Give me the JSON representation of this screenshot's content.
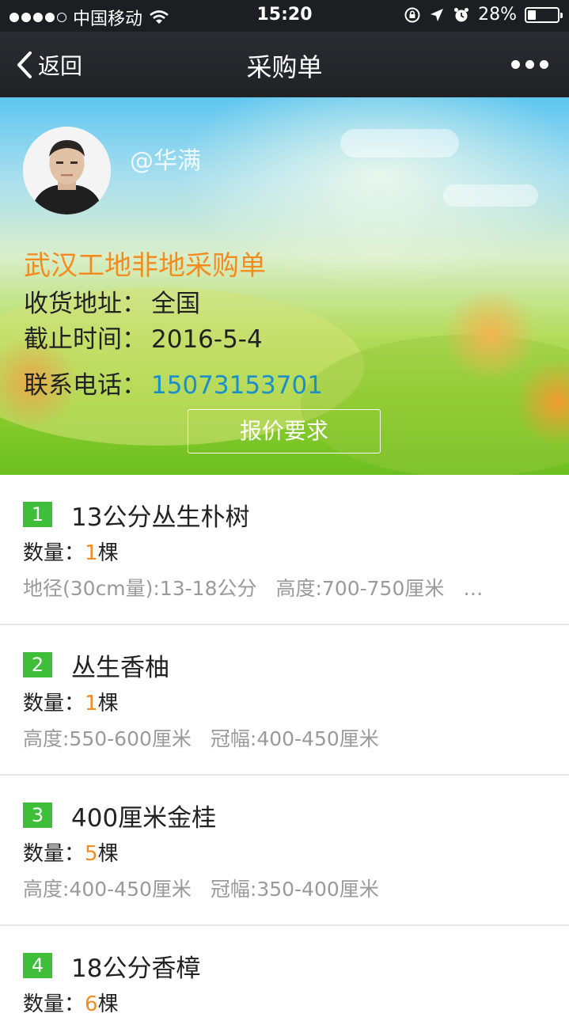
{
  "status_bar": {
    "carrier": "中国移动",
    "time": "15:20",
    "battery": "28%",
    "battery_level": 0.28
  },
  "nav": {
    "back_label": "返回",
    "title": "采购单"
  },
  "header": {
    "username": "@华满",
    "order_title": "武汉工地非地采购单",
    "address_label": "收货地址：",
    "address_value": "全国",
    "deadline_label": "截止时间：",
    "deadline_value": "2016-5-4",
    "phone_label": "联系电话：",
    "phone_value": "15073153701",
    "quote_button": "报价要求"
  },
  "items": [
    {
      "num": "1",
      "name": "13公分丛生朴树",
      "qty_label": "数量：",
      "qty": "1",
      "unit": "棵",
      "spec1": "地径(30cm量):13-18公分",
      "spec2": "高度:700-750厘米",
      "more": "…"
    },
    {
      "num": "2",
      "name": "丛生香柚",
      "qty_label": "数量：",
      "qty": "1",
      "unit": "棵",
      "spec1": "高度:550-600厘米",
      "spec2": "冠幅:400-450厘米"
    },
    {
      "num": "3",
      "name": "400厘米金桂",
      "qty_label": "数量：",
      "qty": "5",
      "unit": "棵",
      "spec1": "高度:400-450厘米",
      "spec2": "冠幅:350-400厘米"
    },
    {
      "num": "4",
      "name": "18公分香樟",
      "qty_label": "数量：",
      "qty": "6",
      "unit": "棵"
    }
  ],
  "colors": {
    "accent_orange": "#f38b1f",
    "phone_blue": "#1a8fc9",
    "badge_green": "#3fbe3a",
    "navbar_dark": "#202226"
  }
}
